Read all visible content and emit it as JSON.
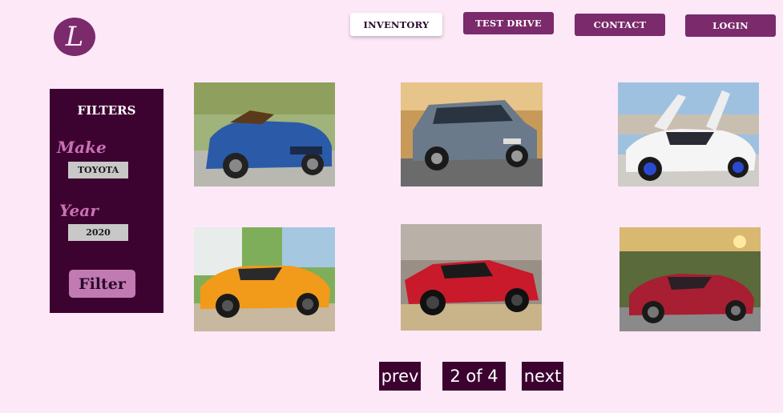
{
  "brand": {
    "logo_letter": "L"
  },
  "nav": {
    "inventory": "INVENTORY",
    "test_drive": "TEST DRIVE",
    "contact": "CONTACT",
    "login": "LOGIN"
  },
  "filters": {
    "title": "FILTERS",
    "make_label": "Make",
    "make_value": "TOYOTA",
    "year_label": "Year",
    "year_value": "2020",
    "button_label": "Filter"
  },
  "pagination": {
    "prev": "prev",
    "indicator": "2 of 4",
    "next": "next"
  },
  "colors": {
    "background": "#fde8f8",
    "accent": "#7b2a6b",
    "panel": "#3d0330",
    "filter_button": "#c27ab3"
  }
}
